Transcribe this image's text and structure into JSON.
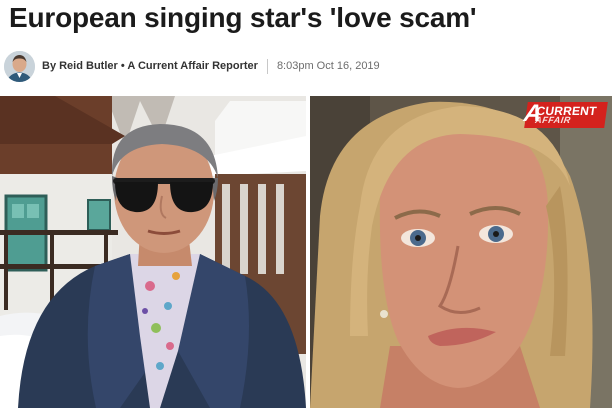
{
  "article": {
    "headline": "European singing star's 'love scam'",
    "byline": "By Reid Butler • A Current Affair Reporter",
    "timestamp": "8:03pm Oct 16, 2019"
  },
  "images": {
    "left": {
      "icon": "man-with-sunglasses-photo"
    },
    "right": {
      "icon": "woman-portrait-photo"
    }
  },
  "logo": {
    "mark": "A",
    "line1": "CURRENT",
    "line2": "AFFAIR",
    "color": "#d4221d"
  }
}
